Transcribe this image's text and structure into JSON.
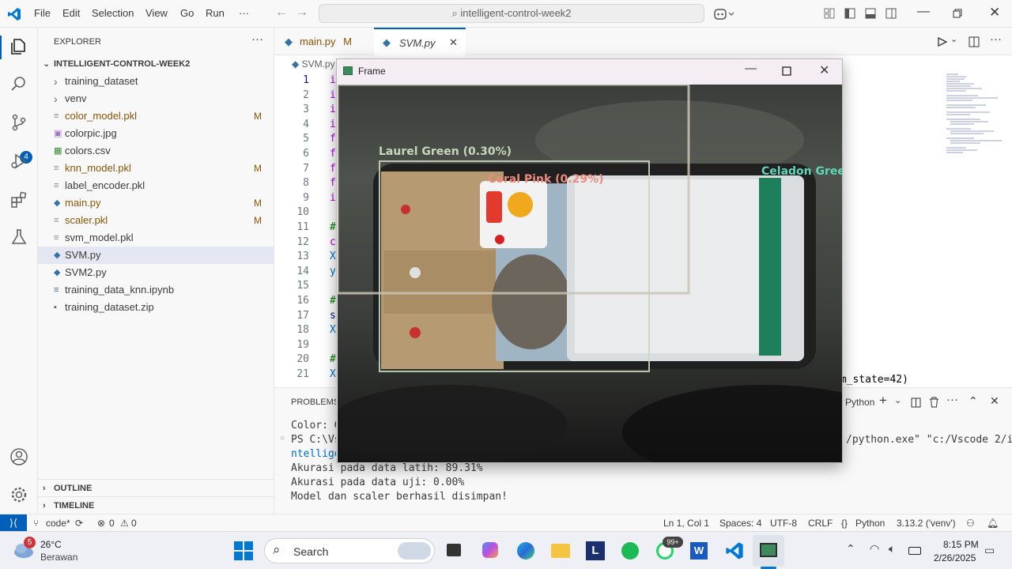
{
  "menu": [
    "File",
    "Edit",
    "Selection",
    "View",
    "Go",
    "Run",
    "···"
  ],
  "command_center": "intelligent-control-week2",
  "scm_badge": "4",
  "explorer": {
    "title": "EXPLORER",
    "root": "INTELLIGENT-CONTROL-WEEK2",
    "items": [
      {
        "label": "training_dataset",
        "badge": "",
        "type": "folder"
      },
      {
        "label": "venv",
        "badge": "",
        "type": "folder"
      },
      {
        "label": "color_model.pkl",
        "badge": "M",
        "type": "file"
      },
      {
        "label": "colorpic.jpg",
        "badge": "",
        "type": "image"
      },
      {
        "label": "colors.csv",
        "badge": "",
        "type": "csv"
      },
      {
        "label": "knn_model.pkl",
        "badge": "M",
        "type": "file"
      },
      {
        "label": "label_encoder.pkl",
        "badge": "",
        "type": "file"
      },
      {
        "label": "main.py",
        "badge": "M",
        "type": "python"
      },
      {
        "label": "scaler.pkl",
        "badge": "M",
        "type": "file"
      },
      {
        "label": "svm_model.pkl",
        "badge": "",
        "type": "file"
      },
      {
        "label": "SVM.py",
        "badge": "",
        "type": "python"
      },
      {
        "label": "SVM2.py",
        "badge": "",
        "type": "python"
      },
      {
        "label": "training_data_knn.ipynb",
        "badge": "",
        "type": "notebook"
      },
      {
        "label": "training_dataset.zip",
        "badge": "",
        "type": "zip"
      }
    ],
    "outline": "OUTLINE",
    "timeline": "TIMELINE"
  },
  "tabs": [
    {
      "label": "main.py",
      "badge": "M"
    },
    {
      "label": "SVM.py",
      "badge": ""
    }
  ],
  "breadcrumb": "SVM.py",
  "editor": {
    "line_numbers": [
      "1",
      "2",
      "3",
      "4",
      "5",
      "6",
      "7",
      "8",
      "9",
      "10",
      "11",
      "12",
      "13",
      "14",
      "15",
      "16",
      "17",
      "18",
      "19",
      "20",
      "21"
    ],
    "visible_code": [
      "i",
      "i",
      "i",
      "i",
      "f",
      "f",
      "f",
      "f",
      "i",
      "",
      "#",
      "c",
      "X",
      "y",
      "",
      "#",
      "s",
      "X",
      "",
      "#",
      "X"
    ],
    "line21_tail": "om_state=42)"
  },
  "panel": {
    "tab_problems": "PROBLEMS",
    "terminal_kind": "Python",
    "lines": [
      "Color: G",
      "PS C:\\Vs",
      "ntellige",
      "Akurasi pada data latih: 89.31%",
      "Akurasi pada data uji: 0.00%",
      "Model dan scaler berhasil disimpan!"
    ],
    "right_fragment": "/python.exe\" \"c:/Vscode 2/i"
  },
  "statusbar": {
    "branch": "code*",
    "errors": "0",
    "warnings": "0",
    "position": "Ln 1, Col 1",
    "spaces": "Spaces: 4",
    "encoding": "UTF-8",
    "eol": "CRLF",
    "language": "Python",
    "interpreter": "3.13.2 ('venv')"
  },
  "frame": {
    "title": "Frame",
    "detections": [
      {
        "label": "Laurel Green (0.30%)",
        "color": "#c8d6bc"
      },
      {
        "label": "Coral Pink (0.29%)",
        "color": "#ee8a7c"
      },
      {
        "label": "Celadon Green",
        "color": "#5fd7b8"
      }
    ]
  },
  "taskbar": {
    "weather_temp": "26°C",
    "weather_desc": "Berawan",
    "weather_badge": "5",
    "search": "Search",
    "whatsapp_badge": "99+",
    "time": "8:15 PM",
    "date": "2/26/2025"
  }
}
